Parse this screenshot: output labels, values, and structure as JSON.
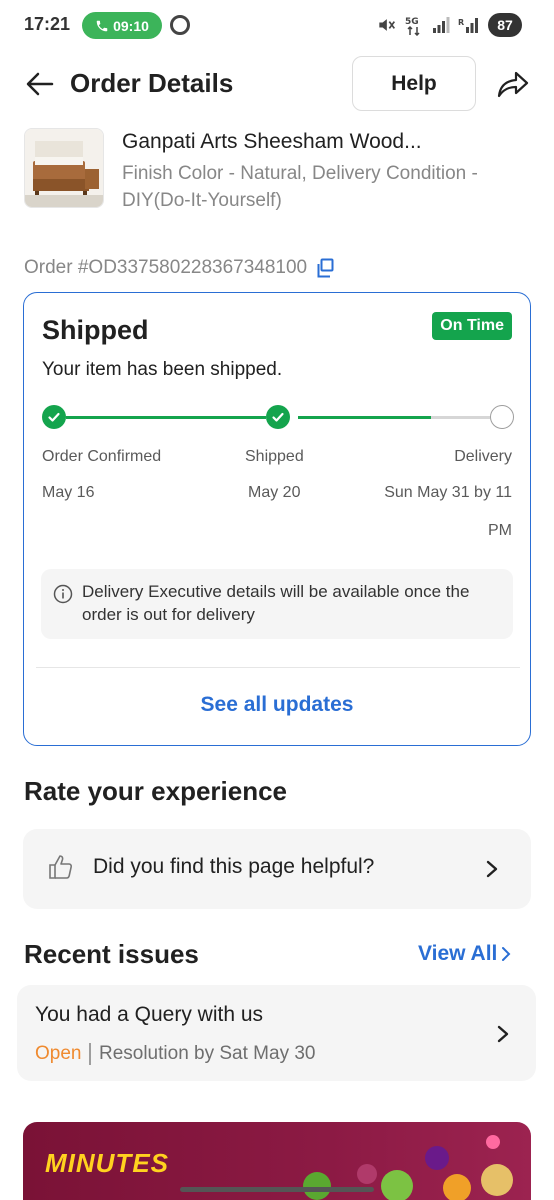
{
  "status_bar": {
    "time": "17:21",
    "call_timer": "09:10",
    "battery": "87"
  },
  "header": {
    "title": "Order Details",
    "help_label": "Help"
  },
  "product": {
    "name": "Ganpati Arts Sheesham Wood...",
    "variant": "Finish Color - Natural, Delivery Condition - DIY(Do-It-Yourself)"
  },
  "order": {
    "id_text": "Order #OD337580228367348100"
  },
  "status_card": {
    "title": "Shipped",
    "badge": "On Time",
    "subtitle": "Your item has been shipped.",
    "steps": [
      {
        "label": "Order Confirmed",
        "date": "May 16",
        "done": true
      },
      {
        "label": "Shipped",
        "date": "May 20",
        "done": true
      },
      {
        "label": "Delivery",
        "date": "Sun May 31 by 11 PM",
        "done": false
      }
    ],
    "info": "Delivery Executive details will be available once the order is out for delivery",
    "see_all": "See all updates"
  },
  "rate": {
    "heading": "Rate your experience",
    "question": "Did you find this page helpful?"
  },
  "recent_issues": {
    "heading": "Recent issues",
    "view_all": "View All",
    "issue": {
      "title": "You had a Query with us",
      "status": "Open",
      "resolution": "Resolution by Sat May 30"
    }
  },
  "banner": {
    "text": "MINUTES"
  },
  "colors": {
    "accent_blue": "#2a6ed4",
    "success_green": "#14a44d",
    "open_orange": "#ef8a2f"
  },
  "icons": [
    "back-arrow-icon",
    "share-icon",
    "copy-icon",
    "check-icon",
    "info-icon",
    "thumbs-up-icon",
    "chevron-right-icon"
  ]
}
